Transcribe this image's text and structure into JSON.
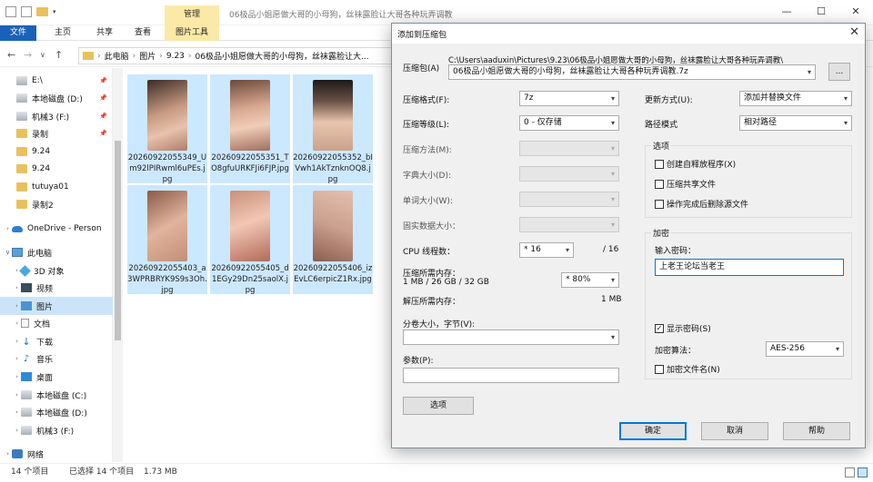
{
  "explorer": {
    "manage_tab": "管理",
    "window_title": "06极品小姐愿做大哥的小母狗，丝袜露脸让大哥各种玩弄调教",
    "ribbon": {
      "file": "文件",
      "home": "主页",
      "share": "共享",
      "view": "查看",
      "picture_tools": "图片工具"
    },
    "address": {
      "crumbs": [
        "此电脑",
        "图片",
        "9.23",
        "06极品小姐愿做大哥的小母狗，丝袜露脸让大..."
      ]
    },
    "nav": [
      {
        "label": "E:\\",
        "icon": "drive-icon",
        "pinned": true
      },
      {
        "label": "本地磁盘 (D:)",
        "icon": "drive-icon",
        "pinned": true
      },
      {
        "label": "机械3 (F:)",
        "icon": "drive-icon",
        "pinned": true
      },
      {
        "label": "录制",
        "icon": "folder-icon",
        "pinned": true
      },
      {
        "label": "9.24",
        "icon": "folder-icon"
      },
      {
        "label": "9.24",
        "icon": "folder-icon"
      },
      {
        "label": "tutuya01",
        "icon": "folder-icon"
      },
      {
        "label": "录制2",
        "icon": "folder-icon"
      },
      {
        "label": "OneDrive - Person",
        "icon": "cloud-icon"
      },
      {
        "label": "此电脑",
        "icon": "pc-icon"
      },
      {
        "label": "3D 对象",
        "icon": "3d-icon"
      },
      {
        "label": "视频",
        "icon": "video-icon"
      },
      {
        "label": "图片",
        "icon": "pictures-icon"
      },
      {
        "label": "文档",
        "icon": "document-icon"
      },
      {
        "label": "下载",
        "icon": "download-icon"
      },
      {
        "label": "音乐",
        "icon": "music-icon"
      },
      {
        "label": "桌面",
        "icon": "desktop-icon"
      },
      {
        "label": "本地磁盘 (C:)",
        "icon": "drive-icon"
      },
      {
        "label": "本地磁盘 (D:)",
        "icon": "drive-icon"
      },
      {
        "label": "机械3 (F:)",
        "icon": "drive-icon"
      },
      {
        "label": "网络",
        "icon": "network-icon"
      }
    ],
    "files": [
      "20260922055349_Um92lPIRwml6uPEs.jpg",
      "20260922055351_TO8gfuURKFJi6FJP.jpg",
      "20260922055352_bIVwh1AkTznknOQ8.jpg",
      "20260922055403_a3WPRBRYK9S9s3Oh.jpg",
      "20260922055405_d1EGy29Dn25saolX.jpg",
      "20260922055406_izEvLC6erpicZ1Rx.jpg"
    ],
    "status": {
      "count": "14 个项目",
      "selected": "已选择 14 个项目",
      "size": "1.73 MB"
    }
  },
  "dialog": {
    "title": "添加到压缩包",
    "archive_label": "压缩包(A)",
    "archive_dir": "C:\\Users\\aaduxin\\Pictures\\9.23\\06极品小姐愿做大哥的小母狗，丝袜露脸让大哥各种玩弄调教\\",
    "archive_name": "06极品小姐愿做大哥的小母狗，丝袜露脸让大哥各种玩弄调教.7z",
    "browse": "...",
    "format_label": "压缩格式(F):",
    "format_value": "7z",
    "level_label": "压缩等级(L):",
    "level_value": "0 - 仅存储",
    "method_label": "压缩方法(M):",
    "dict_label": "字典大小(D):",
    "word_label": "单词大小(W):",
    "solid_label": "固实数据大小：",
    "cpu_label": "CPU 线程数：",
    "cpu_value": "* 16",
    "cpu_total": "/ 16",
    "mem_label": "压缩所需内存：",
    "mem_detail": "1 MB / 26 GB / 32 GB",
    "mem_percent": "* 80%",
    "decomp_label": "解压所需内存：",
    "decomp_value": "1 MB",
    "split_label": "分卷大小，字节(V):",
    "params_label": "参数(P):",
    "options_button": "选项",
    "update_label": "更新方式(U):",
    "update_value": "添加并替换文件",
    "path_label": "路径模式",
    "path_value": "相对路径",
    "options_group": "选项",
    "opt_sfx": "创建自释放程序(X)",
    "opt_shared": "压缩共享文件",
    "opt_delete": "操作完成后删除源文件",
    "encrypt_group": "加密",
    "password_label": "输入密码：",
    "password_value": "上老王论坛当老王",
    "show_password": "显示密码(S)",
    "method_enc_label": "加密算法：",
    "method_enc_value": "AES-256",
    "encrypt_names": "加密文件名(N)",
    "ok": "确定",
    "cancel": "取消",
    "help": "帮助"
  }
}
